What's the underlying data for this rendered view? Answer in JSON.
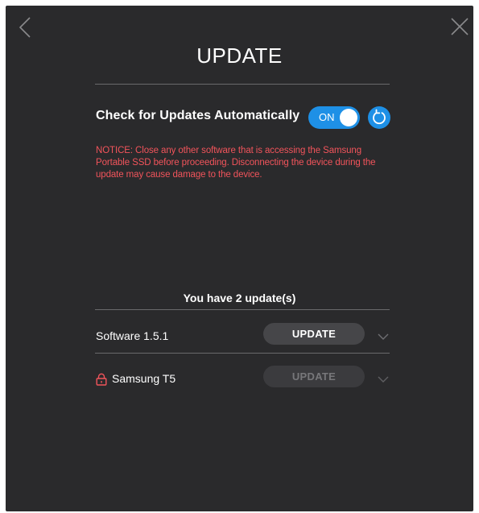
{
  "header": {
    "title": "UPDATE",
    "back_icon": "chevron-left-icon",
    "close_icon": "close-icon"
  },
  "auto_update": {
    "label": "Check for Updates Automatically",
    "toggle_text": "ON",
    "toggle_state": true,
    "refresh_icon": "refresh-icon"
  },
  "notice": "NOTICE: Close any other software that is accessing the Samsung Portable SSD before proceeding. Disconnecting the device during the update may cause damage to the device.",
  "updates": {
    "summary": "You have 2 update(s)",
    "items": [
      {
        "name": "Software 1.5.1",
        "button_label": "UPDATE",
        "enabled": true,
        "locked": false
      },
      {
        "name": "Samsung T5",
        "button_label": "UPDATE",
        "enabled": false,
        "locked": true
      }
    ]
  },
  "colors": {
    "background": "#2a2a2c",
    "accent": "#1e90e6",
    "notice": "#f2545b",
    "divider": "#6a6a6c",
    "lock": "#f2545b"
  }
}
